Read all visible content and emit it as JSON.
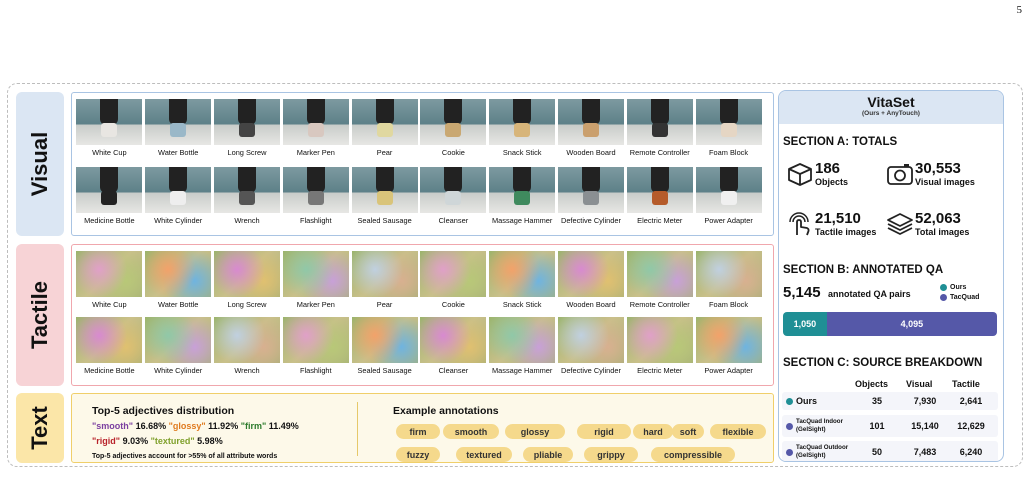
{
  "page_number": "5",
  "row_labels": {
    "visual": "Visual",
    "tactile": "Tactile",
    "text": "Text"
  },
  "row1_captions": [
    "White Cup",
    "Water Bottle",
    "Long Screw",
    "Marker Pen",
    "Pear",
    "Cookie",
    "Snack Stick",
    "Wooden Board",
    "Remote Controller",
    "Foam Block"
  ],
  "row2_captions": [
    "Medicine Bottle",
    "White Cylinder",
    "Wrench",
    "Flashlight",
    "Sealed Sausage",
    "Cleanser",
    "Massage Hammer",
    "Defective Cylinder",
    "Electric Meter",
    "Power Adapter"
  ],
  "text_panel": {
    "adj_title": "Top-5 adjectives distribution",
    "adjectives": [
      {
        "word": "\"smooth\"",
        "pct": "16.68%",
        "color": "#7b3fa0"
      },
      {
        "word": "\"glossy\"",
        "pct": "11.92%",
        "color": "#e07b1f"
      },
      {
        "word": "\"firm\"",
        "pct": "11.49%",
        "color": "#2b7a2b"
      },
      {
        "word": "\"rigid\"",
        "pct": "9.03%",
        "color": "#b8222a"
      },
      {
        "word": "\"textured\"",
        "pct": "5.98%",
        "color": "#7fa02b"
      }
    ],
    "adj_note": "Top-5 adjectives account for >55% of all attribute words",
    "example_title": "Example annotations",
    "pills_row1": [
      "firm",
      "smooth",
      "glossy",
      "rigid",
      "hard",
      "soft",
      "flexible"
    ],
    "pills_row2": [
      "fuzzy",
      "textured",
      "pliable",
      "grippy",
      "compressible"
    ]
  },
  "sidebar": {
    "title": "VitaSet",
    "subtitle": "(Ours + AnyTouch)",
    "section_a": "SECTION A: TOTALS",
    "stats": [
      {
        "value": "186",
        "label": "Objects",
        "icon": "cube-icon"
      },
      {
        "value": "30,553",
        "label": "Visual images",
        "icon": "camera-icon"
      },
      {
        "value": "21,510",
        "label": "Tactile images",
        "icon": "touch-icon"
      },
      {
        "value": "52,063",
        "label": "Total images",
        "icon": "layers-icon"
      }
    ],
    "section_b": "SECTION B: ANNOTATED QA",
    "qa_total": "5,145",
    "qa_label": "annotated QA pairs",
    "legend": [
      {
        "name": "Ours",
        "color": "#1f8f95"
      },
      {
        "name": "TacQuad",
        "color": "#5558a8"
      }
    ],
    "qa_bar": [
      {
        "name": "Ours",
        "value": 1050,
        "label": "1,050"
      },
      {
        "name": "TacQuad",
        "value": 4095,
        "label": "4,095"
      }
    ],
    "section_c": "SECTION C: SOURCE BREAKDOWN",
    "columns": [
      "Objects",
      "Visual",
      "Tactile"
    ],
    "rows": [
      {
        "name": "Ours",
        "objects": "35",
        "visual": "7,930",
        "tactile": "2,641",
        "color": "#1f8f95"
      },
      {
        "name": "TacQuad Indoor (GelSight)",
        "objects": "101",
        "visual": "15,140",
        "tactile": "12,629",
        "color": "#5558a8"
      },
      {
        "name": "TacQuad Outdoor (GelSight)",
        "objects": "50",
        "visual": "7,483",
        "tactile": "6,240",
        "color": "#5558a8"
      }
    ]
  }
}
